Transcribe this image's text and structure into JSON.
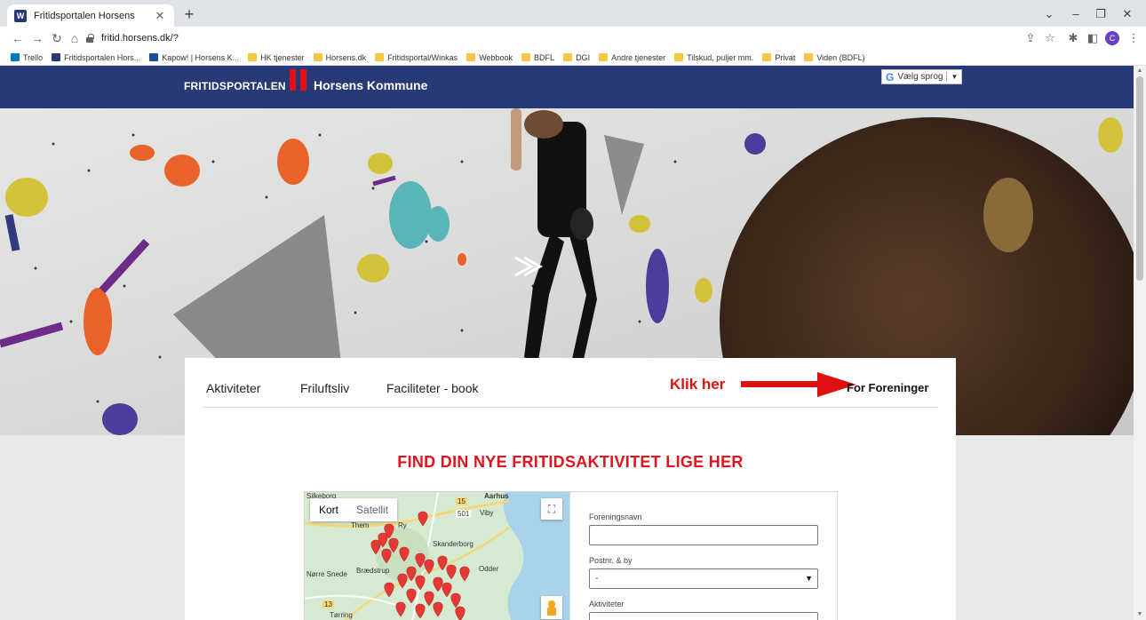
{
  "browser": {
    "tab_title": "Fritidsportalen Horsens",
    "tab_favicon": "W",
    "url": "fritid.horsens.dk/?",
    "profile_initial": "C",
    "bookmarks": [
      {
        "label": "Trello",
        "icon": "trello"
      },
      {
        "label": "Fritidsportalen Hors...",
        "icon": "w"
      },
      {
        "label": "Kapow! | Horsens K...",
        "icon": "page"
      },
      {
        "label": "HK tjenester",
        "icon": "folder"
      },
      {
        "label": "Horsens.dk",
        "icon": "folder"
      },
      {
        "label": "Fritidsportal/Winkas",
        "icon": "folder"
      },
      {
        "label": "Webbook",
        "icon": "folder"
      },
      {
        "label": "BDFL",
        "icon": "folder"
      },
      {
        "label": "DGI",
        "icon": "folder"
      },
      {
        "label": "Andre tjenester",
        "icon": "folder"
      },
      {
        "label": "Tilskud, puljer mm.",
        "icon": "folder"
      },
      {
        "label": "Privat",
        "icon": "folder"
      },
      {
        "label": "Viden (BDFL)",
        "icon": "folder"
      }
    ]
  },
  "header": {
    "brand_left": "FRITIDSPORTALEN",
    "brand_right": "Horsens Kommune",
    "language_button": "Vælg sprog",
    "colors": {
      "header_bg": "#283a75",
      "brand_red": "#e3101a"
    }
  },
  "nav": {
    "items": [
      "Aktiviteter",
      "Friluftsliv",
      "Faciliteter - book"
    ],
    "annotation": "Klik her",
    "for_foreninger": "For Foreninger"
  },
  "main": {
    "title": "FIND DIN NYE FRITIDSAKTIVITET LIGE HER",
    "title_color": "#e0141e"
  },
  "map": {
    "toggle": {
      "map": "Kort",
      "satellite": "Satellit"
    },
    "places": [
      "Aarhus",
      "Viby",
      "Them",
      "Ry",
      "Skanderborg",
      "Odder",
      "Nørre Snede",
      "Brædstrup",
      "Tørring",
      "Silkeborg"
    ],
    "roads": [
      "15",
      "501",
      "13"
    ]
  },
  "form": {
    "foreningsnavn_label": "Foreningsnavn",
    "foreningsnavn_value": "",
    "postnr_label": "Postnr. & by",
    "postnr_value": "-",
    "aktiviteter_label": "Aktiviteter"
  }
}
